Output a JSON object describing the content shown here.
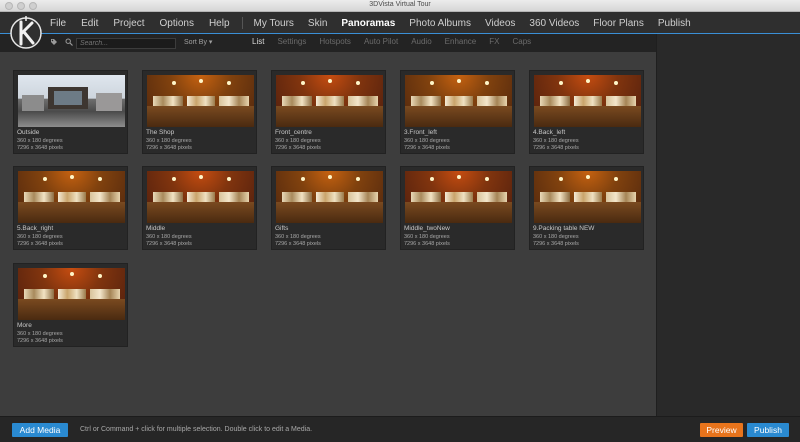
{
  "window": {
    "title": "3DVista Virtual Tour"
  },
  "menu": {
    "items": [
      "File",
      "Edit",
      "Project",
      "Options",
      "Help"
    ],
    "nav": [
      "My Tours",
      "Skin",
      "Panoramas",
      "Photo Albums",
      "Videos",
      "360 Videos",
      "Floor Plans",
      "Publish"
    ],
    "active_nav": "Panoramas"
  },
  "toolbar": {
    "search_placeholder": "Search...",
    "sort_label": "Sort By ▾",
    "tabs": [
      "List",
      "Settings",
      "Hotspots",
      "Auto Pilot",
      "Audio",
      "Enhance",
      "FX",
      "Caps"
    ],
    "active_tab": "List"
  },
  "panoramas": [
    {
      "name": "Outside",
      "fov": "360 x 180 degrees",
      "size": "7296 x 3648 pixels",
      "scene": "outdoor"
    },
    {
      "name": "The Shop",
      "fov": "360 x 180 degrees",
      "size": "7296 x 3648 pixels",
      "scene": "shop"
    },
    {
      "name": "Front_centre",
      "fov": "360 x 180 degrees",
      "size": "7296 x 3648 pixels",
      "scene": "shop"
    },
    {
      "name": "3.Front_left",
      "fov": "360 x 180 degrees",
      "size": "7296 x 3648 pixels",
      "scene": "shop"
    },
    {
      "name": "4.Back_left",
      "fov": "360 x 180 degrees",
      "size": "7296 x 3648 pixels",
      "scene": "shop"
    },
    {
      "name": "5.Back_right",
      "fov": "360 x 180 degrees",
      "size": "7296 x 3648 pixels",
      "scene": "shop"
    },
    {
      "name": "Middle",
      "fov": "360 x 180 degrees",
      "size": "7296 x 3648 pixels",
      "scene": "shop"
    },
    {
      "name": "Gifts",
      "fov": "360 x 180 degrees",
      "size": "7296 x 3648 pixels",
      "scene": "shop"
    },
    {
      "name": "Middle_twoNew",
      "fov": "360 x 180 degrees",
      "size": "7296 x 3648 pixels",
      "scene": "shop"
    },
    {
      "name": "9.Packing table NEW",
      "fov": "360 x 180 degrees",
      "size": "7296 x 3648 pixels",
      "scene": "shop"
    },
    {
      "name": "More",
      "fov": "360 x 180 degrees",
      "size": "7296 x 3648 pixels",
      "scene": "shop"
    }
  ],
  "footer": {
    "add_media": "Add Media",
    "hint": "Ctrl or Command + click for multiple selection. Double click to edit a Media.",
    "preview": "Preview",
    "publish": "Publish"
  },
  "colors": {
    "accent": "#2a8ad1",
    "preview": "#e8741c",
    "background": "#3d3d3d"
  },
  "icons": {
    "logo": "3dvista-logo-icon",
    "tag": "tag-icon",
    "search": "search-icon",
    "sort": "chevron-down-icon"
  }
}
